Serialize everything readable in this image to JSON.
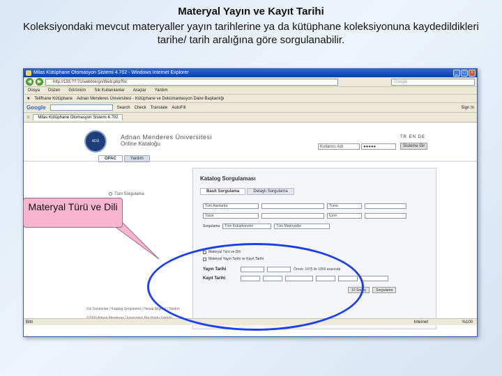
{
  "slide": {
    "title": "Materyal Yayın ve Kayıt Tarihi",
    "subtitle": "Koleksiyondaki mevcut materyaller yayın tarihlerine ya da kütüphane koleksiyonuna kaydedildikleri tarihe/ tarih aralığına göre sorgulanabilir.",
    "callout": "Materyal Türü ve Dili"
  },
  "browser": {
    "title": "Milas Kütüphane Otomasyon Sistemi 4.702 - Windows Internet Explorer",
    "address": "http://193.??.?1/webtokrgn/Web.php?lst",
    "search_placeholder": "Google",
    "menu": [
      "Dosya",
      "Düzen",
      "Görünüm",
      "Sık Kullanılanlar",
      "Araçlar",
      "Yardım"
    ],
    "favorites": [
      "Telifhane Kütüphane",
      "Adnan Menderes Üniversitesi - Kütüphane ve Dokümantasyon Daire Başkanlığı"
    ],
    "google_bar": [
      "Google",
      "Search",
      "Check",
      "Translate",
      "AutoFill",
      "Sign In"
    ],
    "tab_label": "Milas Kütüphane Otomasyon Sistemi 4.702",
    "status_left": "Bitti",
    "status_zone": "Internet",
    "status_zoom": "%100"
  },
  "page": {
    "university": "Adnan Menderes Üniversitesi",
    "catalog": "Online Kataloğu",
    "login_user": "Kullanıcı Adı",
    "login_pass": "●●●●●",
    "langs": "TR EN DE",
    "login_button": "Sisteme Gir",
    "tabs": [
      "OPAC",
      "Yardım"
    ],
    "left_option": "Tüm Sorgulama",
    "panel_title": "Katalog Sorgulaması",
    "search_tabs": [
      "Basit Sorgulama",
      "Detaylı Sorgulama"
    ],
    "row1": [
      "Tüm Alanlarda",
      "Tümü"
    ],
    "row2": [
      "Yazar",
      "İçerir"
    ],
    "row3_label": "Sorgulama",
    "row3_values": [
      "Tüm Kütüphaneler",
      "Tüm Materyaller"
    ],
    "materyal_turu": "Materyal Türü ve Dili",
    "materyal_tarih": "Materyal Yayın Tarihi ve Kayıt Tarihi",
    "yayin_tarihi": "Yayın Tarihi",
    "kayit_tarihi": "Kayıt Tarihi",
    "ornek": "Örnek: 1975 ile 1800 arasında",
    "result_button": "10 Sonuç",
    "search_button": "Sorgulama",
    "footer1": "Sık Sorulanlar | Katalog Sorgulama | Hesap Bilgileri | Yardım",
    "footer2": "©2000 Adnan Menderes Üniversitesi Her Hakkı Saklıdır."
  }
}
